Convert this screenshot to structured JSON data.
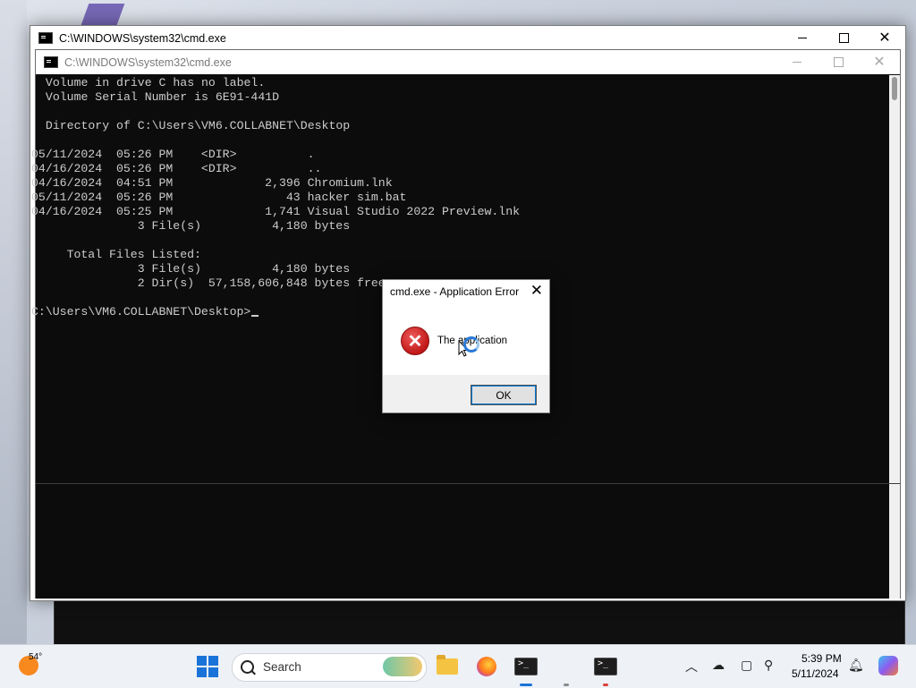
{
  "outer_window": {
    "title": "C:\\WINDOWS\\system32\\cmd.exe"
  },
  "inner_window": {
    "title": "C:\\WINDOWS\\system32\\cmd.exe"
  },
  "console_lines": [
    " Volume in drive C has no label.",
    " Volume Serial Number is 6E91-441D",
    "",
    " Directory of C:\\Users\\VM6.COLLABNET\\Desktop",
    "",
    "05/11/2024  05:26 PM    <DIR>          .",
    "04/16/2024  05:26 PM    <DIR>          ..",
    "04/16/2024  04:51 PM             2,396 Chromium.lnk",
    "05/11/2024  05:26 PM                43 hacker sim.bat",
    "04/16/2024  05:25 PM             1,741 Visual Studio 2022 Preview.lnk",
    "               3 File(s)          4,180 bytes",
    "",
    "     Total Files Listed:",
    "               3 File(s)          4,180 bytes",
    "               2 Dir(s)  57,158,606,848 bytes free",
    "",
    "C:\\Users\\VM6.COLLABNET\\Desktop>"
  ],
  "dialog": {
    "title": "cmd.exe - Application Error",
    "message": "The application",
    "ok_label": "OK",
    "close_glyph": "✕",
    "icon_glyph": "✕"
  },
  "taskbar": {
    "weather_temp": "54°",
    "search_label": "Search",
    "time": "5:39 PM",
    "date": "5/11/2024",
    "accent_color": "#1a73d9",
    "terminal_active_color": "#e0403a"
  }
}
